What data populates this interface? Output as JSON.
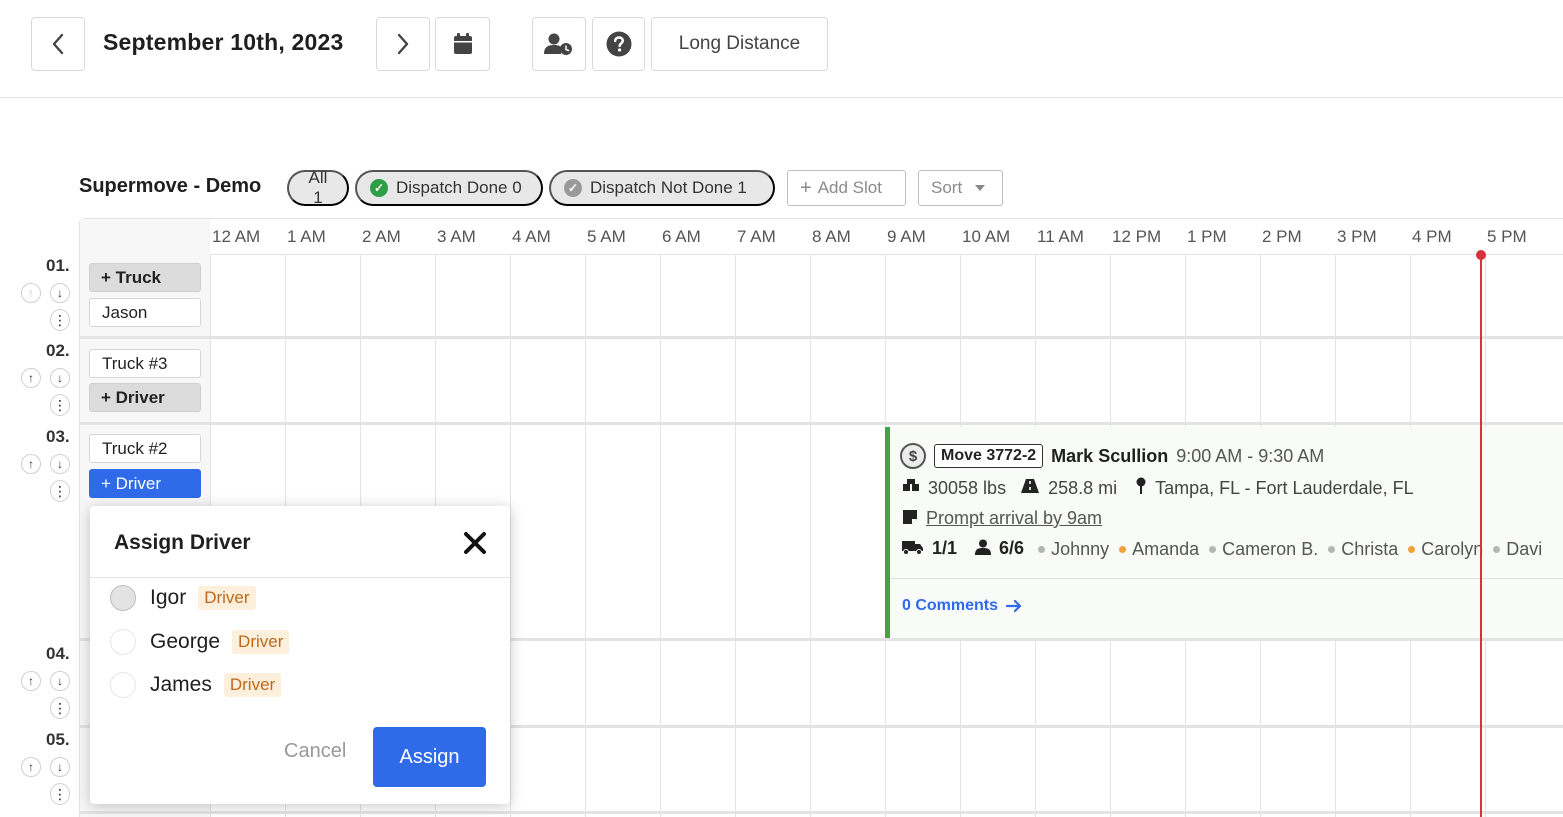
{
  "header": {
    "date": "September 10th, 2023",
    "long_distance_label": "Long Distance"
  },
  "filters": {
    "org_name": "Supermove - Demo",
    "all_label": "All 1",
    "dispatch_done_label": "Dispatch Done 0",
    "dispatch_not_done_label": "Dispatch Not Done 1",
    "add_slot_label": "Add Slot",
    "sort_label": "Sort"
  },
  "hours": [
    "12 AM",
    "1 AM",
    "2 AM",
    "3 AM",
    "4 AM",
    "5 AM",
    "6 AM",
    "7 AM",
    "8 AM",
    "9 AM",
    "10 AM",
    "11 AM",
    "12 PM",
    "1 PM",
    "2 PM",
    "3 PM",
    "4 PM",
    "5 PM"
  ],
  "slots": [
    {
      "number": "01.",
      "truck": "+ Truck",
      "driver": "Jason"
    },
    {
      "number": "02.",
      "truck": "Truck #3",
      "driver": "+ Driver"
    },
    {
      "number": "03.",
      "truck": "Truck #2",
      "driver": "+ Driver"
    },
    {
      "number": "04."
    },
    {
      "number": "05."
    }
  ],
  "job": {
    "move_id": "Move 3772-2",
    "customer": "Mark Scullion",
    "time": "9:00 AM - 9:30 AM",
    "weight": "30058 lbs",
    "distance": "258.8 mi",
    "route": "Tampa, FL - Fort Lauderdale, FL",
    "note": "Prompt arrival by 9am",
    "trucks": "1/1",
    "movers": "6/6",
    "crew": [
      {
        "name": "Johnny",
        "color": "#b5b5b5"
      },
      {
        "name": "Amanda",
        "color": "#f0a13a"
      },
      {
        "name": "Cameron B.",
        "color": "#b5b5b5"
      },
      {
        "name": "Christa",
        "color": "#b5b5b5"
      },
      {
        "name": "Carolyn",
        "color": "#f0a13a"
      },
      {
        "name": "Davi",
        "color": "#b5b5b5"
      }
    ],
    "comments_label": "0 Comments"
  },
  "modal": {
    "title": "Assign Driver",
    "options": [
      {
        "name": "Igor",
        "role": "Driver"
      },
      {
        "name": "George",
        "role": "Driver"
      },
      {
        "name": "James",
        "role": "Driver"
      }
    ],
    "cancel_label": "Cancel",
    "assign_label": "Assign"
  },
  "colors": {
    "primary": "#2f6be8",
    "now_line": "#d8323c",
    "job_accent": "#46a049",
    "done_check": "#2e9e44"
  }
}
